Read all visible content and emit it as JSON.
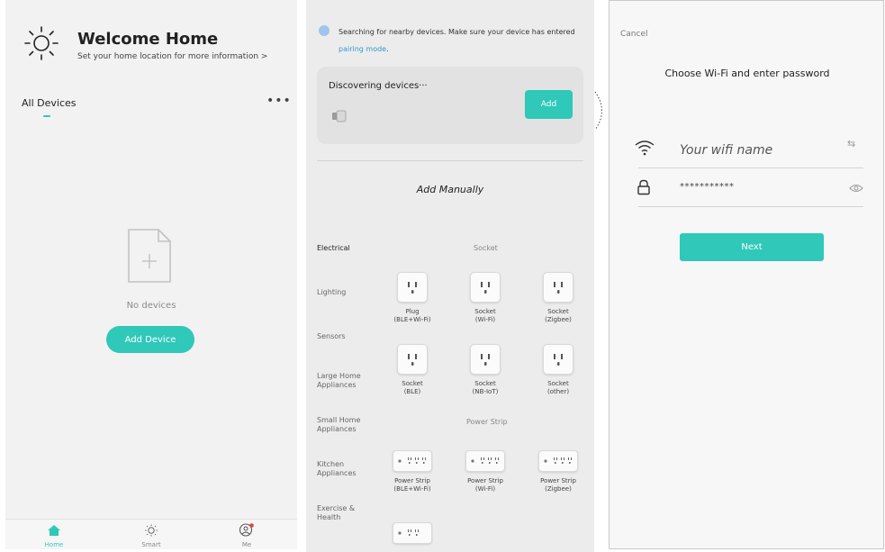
{
  "home": {
    "title": "Welcome Home",
    "subtitle": "Set your home location for more information",
    "subtitle_arrow": ">",
    "all_devices": "All Devices",
    "more": "•••",
    "empty_text": "No devices",
    "add_device": "Add Device",
    "tabs": [
      {
        "label": "Home",
        "icon": "home-icon",
        "active": true
      },
      {
        "label": "Smart",
        "icon": "sun-icon",
        "active": false
      },
      {
        "label": "Me",
        "icon": "user-icon",
        "active": false
      }
    ]
  },
  "discover": {
    "searching_text": "Searching for nearby devices. Make sure your device has entered ",
    "pairing_link": "pairing mode",
    "searching_end": ".",
    "card_title": "Discovering devices···",
    "add_button": "Add",
    "add_manually": "Add Manually",
    "categories": [
      "Electrical",
      "Lighting",
      "Sensors",
      "Large Home Appliances",
      "Small Home Appliances",
      "Kitchen Appliances",
      "Exercise & Health"
    ],
    "sections": [
      "Socket",
      "Power Strip"
    ],
    "socket_devices": [
      {
        "l1": "Plug",
        "l2": "(BLE+Wi-Fi)"
      },
      {
        "l1": "Socket",
        "l2": "(Wi-Fi)"
      },
      {
        "l1": "Socket",
        "l2": "(Zigbee)"
      },
      {
        "l1": "Socket",
        "l2": "(BLE)"
      },
      {
        "l1": "Socket",
        "l2": "(NB-IoT)"
      },
      {
        "l1": "Socket",
        "l2": "(other)"
      }
    ],
    "strip_devices": [
      {
        "l1": "Power Strip",
        "l2": "(BLE+Wi-Fi)"
      },
      {
        "l1": "Power Strip",
        "l2": "(Wi-Fi)"
      },
      {
        "l1": "Power Strip",
        "l2": "(Zigbee)"
      }
    ]
  },
  "wifi": {
    "cancel": "Cancel",
    "title": "Choose Wi-Fi and enter password",
    "ssid": "Your wifi name",
    "password": "***********",
    "next": "Next"
  },
  "colors": {
    "accent": "#2fc8b9",
    "link": "#2f9cc9"
  }
}
